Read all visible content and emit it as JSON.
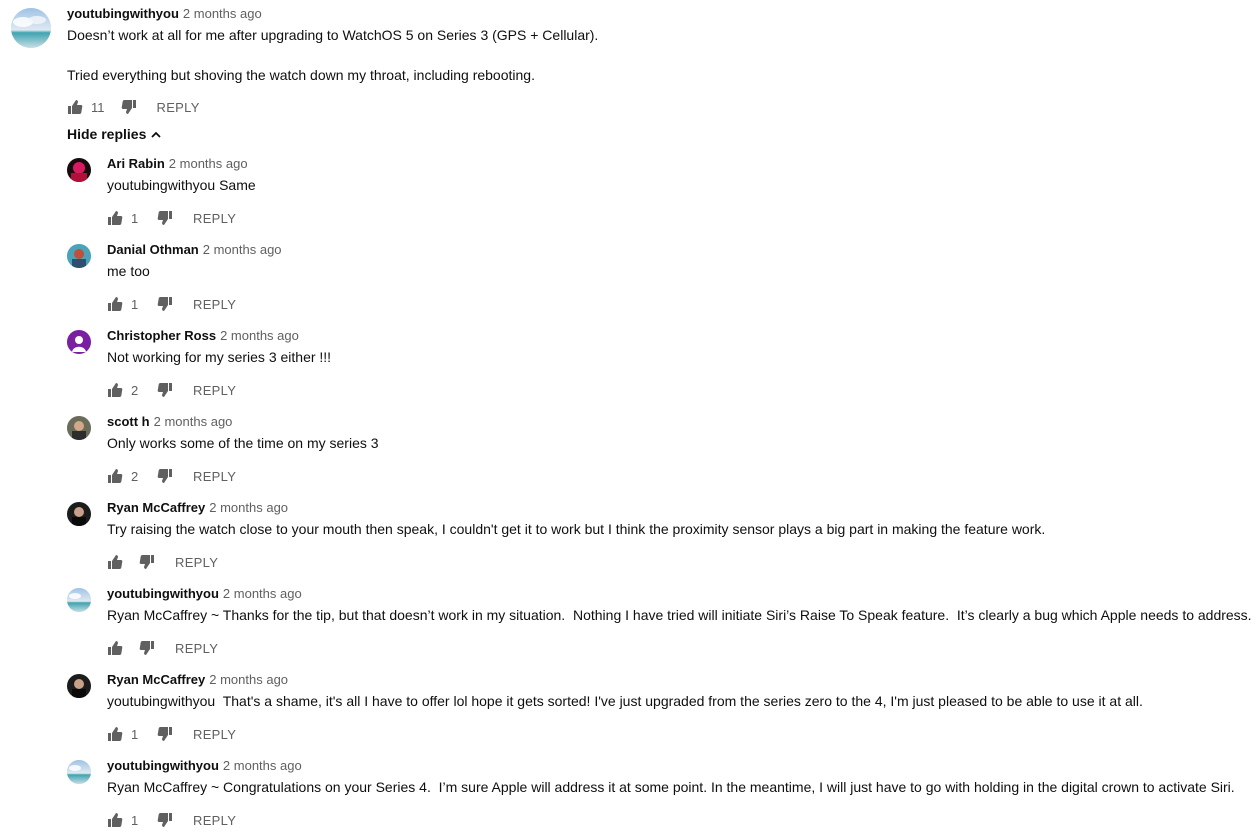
{
  "top_comment": {
    "author": "youtubingwithyou",
    "time": "2 months ago",
    "text": "Doesn’t work at all for me after upgrading to WatchOS 5 on Series 3 (GPS + Cellular).\n\nTried everything but shoving the watch down my throat, including rebooting.",
    "likes": "11",
    "reply_label": "REPLY"
  },
  "hide_replies_label": "Hide replies",
  "replies": [
    {
      "author": "Ari Rabin",
      "time": "2 months ago",
      "text": "youtubingwithyou Same",
      "likes": "1",
      "reply_label": "REPLY"
    },
    {
      "author": "Danial Othman",
      "time": "2 months ago",
      "text": "me too",
      "likes": "1",
      "reply_label": "REPLY"
    },
    {
      "author": "Christopher Ross",
      "time": "2 months ago",
      "text": "Not working for my series 3 either !!!",
      "likes": "2",
      "reply_label": "REPLY"
    },
    {
      "author": "scott h",
      "time": "2 months ago",
      "text": "Only works some of the time on my series 3",
      "likes": "2",
      "reply_label": "REPLY"
    },
    {
      "author": "Ryan McCaffrey",
      "time": "2 months ago",
      "text": "Try raising the watch close to your mouth then speak, I couldn't get it to work but I think the proximity sensor plays a big part in making the feature work.",
      "likes": "",
      "reply_label": "REPLY"
    },
    {
      "author": "youtubingwithyou",
      "time": "2 months ago",
      "text": "Ryan McCaffrey ~ Thanks for the tip, but that doesn’t work in my situation.  Nothing I have tried will initiate Siri’s Raise To Speak feature.  It’s clearly a bug which Apple needs to address.",
      "likes": "",
      "reply_label": "REPLY"
    },
    {
      "author": "Ryan McCaffrey",
      "time": "2 months ago",
      "text": "youtubingwithyou  That's a shame, it's all I have to offer lol hope it gets sorted! I've just upgraded from the series zero to the 4, I'm just pleased to be able to use it at all.",
      "likes": "1",
      "reply_label": "REPLY"
    },
    {
      "author": "youtubingwithyou",
      "time": "2 months ago",
      "text": "Ryan McCaffrey ~ Congratulations on your Series 4.  I’m sure Apple will address it at some point. In the meantime, I will just have to go with holding in the digital crown to activate Siri.",
      "likes": "1",
      "reply_label": "REPLY"
    }
  ],
  "avatars": {
    "youtubingwithyou": "sky-sea-icon",
    "Ari Rabin": "red-pink-avatar-icon",
    "Danial Othman": "illustrated-portrait-avatar-icon",
    "Christopher Ross": "letter-avatar-icon",
    "scott h": "photo-portrait-avatar-icon",
    "Ryan McCaffrey": "dark-portrait-avatar-icon"
  },
  "colors": {
    "text": "#0f0f0f",
    "secondary": "#606060",
    "christopher_avatar_bg": "#7b1fa2"
  }
}
